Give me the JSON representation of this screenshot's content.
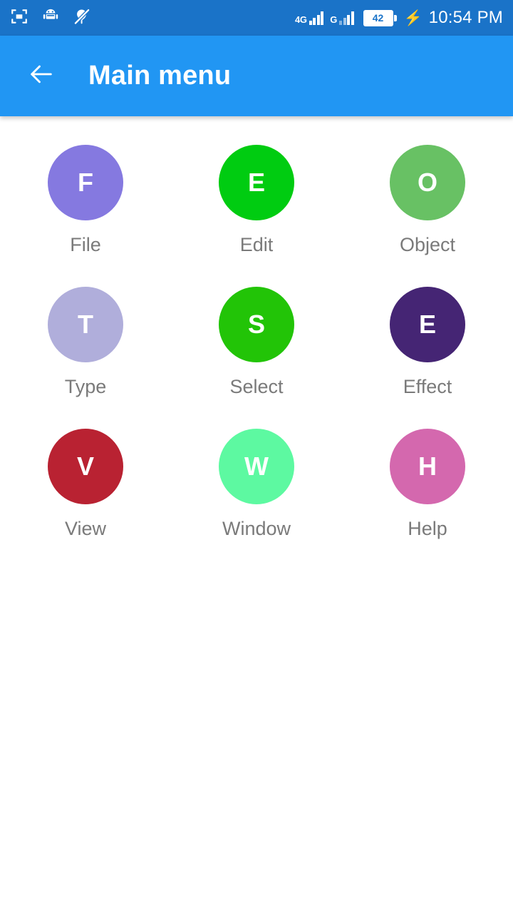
{
  "status_bar": {
    "background_color": "#1a73c8",
    "left_icons": [
      {
        "name": "screenshot-capture-icon"
      },
      {
        "name": "android-robot-icon"
      },
      {
        "name": "balloon-muted-icon"
      }
    ],
    "sim1_network_label": "4G",
    "sim2_network_label": "G",
    "battery_level": "42",
    "charging": true,
    "time": "10:54 PM"
  },
  "app_bar": {
    "background_color": "#2196f3",
    "back_label": "back-arrow",
    "title": "Main menu"
  },
  "menu": {
    "items": [
      {
        "letter": "F",
        "label": "File",
        "color": "#8579e0"
      },
      {
        "letter": "E",
        "label": "Edit",
        "color": "#00cc11"
      },
      {
        "letter": "O",
        "label": "Object",
        "color": "#68c164"
      },
      {
        "letter": "T",
        "label": "Type",
        "color": "#b0aedb"
      },
      {
        "letter": "S",
        "label": "Select",
        "color": "#22c407"
      },
      {
        "letter": "E",
        "label": "Effect",
        "color": "#452574"
      },
      {
        "letter": "V",
        "label": "View",
        "color": "#b92232"
      },
      {
        "letter": "W",
        "label": "Window",
        "color": "#5df9a1"
      },
      {
        "letter": "H",
        "label": "Help",
        "color": "#d468ae"
      }
    ]
  }
}
